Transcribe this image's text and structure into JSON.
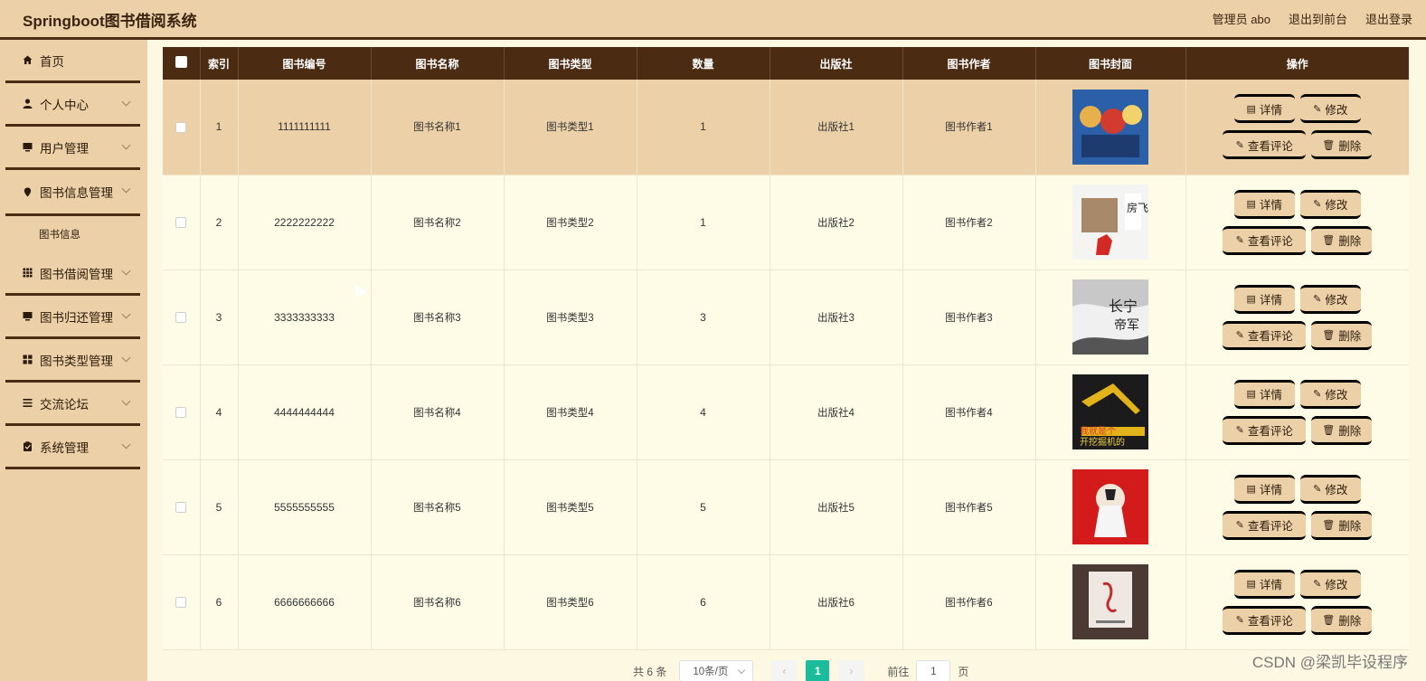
{
  "app": {
    "title": "Springboot图书借阅系统",
    "user_label": "管理员 abo",
    "back_to_front": "退出到前台",
    "logout": "退出登录"
  },
  "sidebar": {
    "items": [
      {
        "label": "首页",
        "icon": "home-icon"
      },
      {
        "label": "个人中心",
        "icon": "user-icon"
      },
      {
        "label": "用户管理",
        "icon": "monitor-icon"
      },
      {
        "label": "图书信息管理",
        "icon": "location-icon"
      },
      {
        "label": "图书借阅管理",
        "icon": "grid-icon"
      },
      {
        "label": "图书归还管理",
        "icon": "monitor-icon"
      },
      {
        "label": "图书类型管理",
        "icon": "apps-icon"
      },
      {
        "label": "交流论坛",
        "icon": "list-icon"
      },
      {
        "label": "系统管理",
        "icon": "clipboard-icon"
      }
    ],
    "sub_item": "图书信息"
  },
  "table": {
    "headers": [
      "索引",
      "图书编号",
      "图书名称",
      "图书类型",
      "数量",
      "出版社",
      "图书作者",
      "图书封面",
      "操作"
    ],
    "rows": [
      {
        "index": "1",
        "code": "1111111111",
        "name": "图书名称1",
        "type": "图书类型1",
        "qty": "1",
        "publisher": "出版社1",
        "author": "图书作者1"
      },
      {
        "index": "2",
        "code": "2222222222",
        "name": "图书名称2",
        "type": "图书类型2",
        "qty": "1",
        "publisher": "出版社2",
        "author": "图书作者2"
      },
      {
        "index": "3",
        "code": "3333333333",
        "name": "图书名称3",
        "type": "图书类型3",
        "qty": "3",
        "publisher": "出版社3",
        "author": "图书作者3"
      },
      {
        "index": "4",
        "code": "4444444444",
        "name": "图书名称4",
        "type": "图书类型4",
        "qty": "4",
        "publisher": "出版社4",
        "author": "图书作者4"
      },
      {
        "index": "5",
        "code": "5555555555",
        "name": "图书名称5",
        "type": "图书类型5",
        "qty": "5",
        "publisher": "出版社5",
        "author": "图书作者5"
      },
      {
        "index": "6",
        "code": "6666666666",
        "name": "图书名称6",
        "type": "图书类型6",
        "qty": "6",
        "publisher": "出版社6",
        "author": "图书作者6"
      }
    ],
    "actions": {
      "detail": "详情",
      "edit": "修改",
      "comments": "查看评论",
      "delete": "删除"
    }
  },
  "pagination": {
    "total": "共 6 条",
    "page_size": "10条/页",
    "current_page": "1",
    "goto_prefix": "前往",
    "goto_value": "1",
    "goto_suffix": "页"
  },
  "watermark": "CSDN @梁凯毕设程序",
  "colors": {
    "header_bg": "#ecd0a8",
    "accent_dark": "#4b2c13",
    "row_bg": "#fefbe6",
    "page_active": "#1abc9c"
  }
}
